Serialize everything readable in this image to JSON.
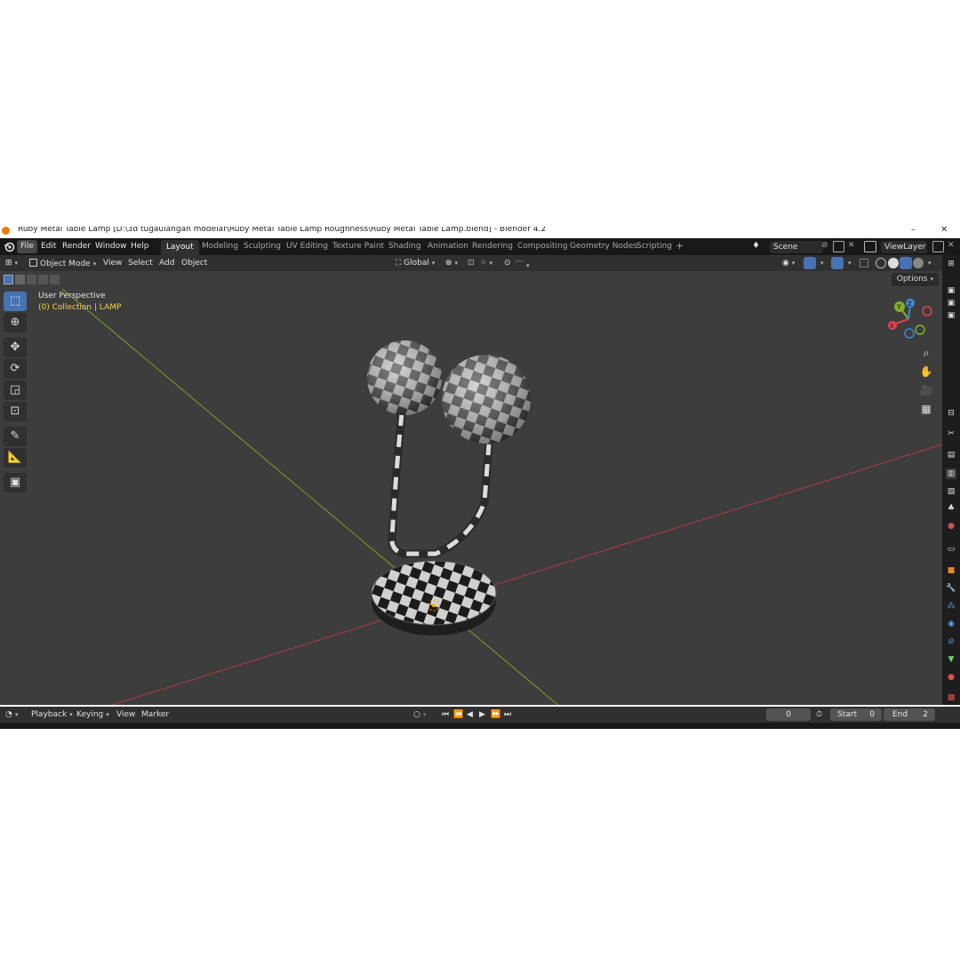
{
  "title_bar": {
    "text": "Ruby Metal Table Lamp [D:\\3d tugaulangan modelar\\Ruby Metal Table Lamp Roughness\\Ruby Metal Table Lamp.blend] - Blender 4.2",
    "min": "–",
    "close": "✕"
  },
  "menu": [
    "File",
    "Edit",
    "Render",
    "Window",
    "Help"
  ],
  "workspaces": [
    "Layout",
    "Modeling",
    "Sculpting",
    "UV Editing",
    "Texture Paint",
    "Shading",
    "Animation",
    "Rendering",
    "Compositing",
    "Geometry Nodes",
    "Scripting"
  ],
  "add_workspace": "+",
  "scene": {
    "value": "Scene"
  },
  "view_layer": {
    "value": "ViewLayer"
  },
  "header": {
    "mode": "Object Mode",
    "view": "View",
    "select": "Select",
    "add": "Add",
    "object": "Object",
    "orientation": "Global"
  },
  "viewport": {
    "perspective": "User Perspective",
    "collection": "(0) Collection | LAMP",
    "options": "Options",
    "gizmo": {
      "x": "X",
      "y": "Y",
      "z": "Z"
    },
    "colors": {
      "x_axis": "#e0434f",
      "y_axis": "#7fb226",
      "z_axis": "#3f88d6",
      "text_yellow": "#f2d24a"
    }
  },
  "toolbar": {
    "tools": [
      "select-box-icon",
      "cursor-icon",
      "move-icon",
      "rotate-icon",
      "scale-icon",
      "transform-icon",
      "annotate-icon",
      "measure-icon",
      "add-cube-icon"
    ]
  },
  "timeline": {
    "playback": "Playback",
    "keying": "Keying",
    "view": "View",
    "marker": "Marker",
    "current_frame": "0",
    "start_label": "Start",
    "start_value": "0",
    "end_label": "End",
    "end_value": "2"
  }
}
